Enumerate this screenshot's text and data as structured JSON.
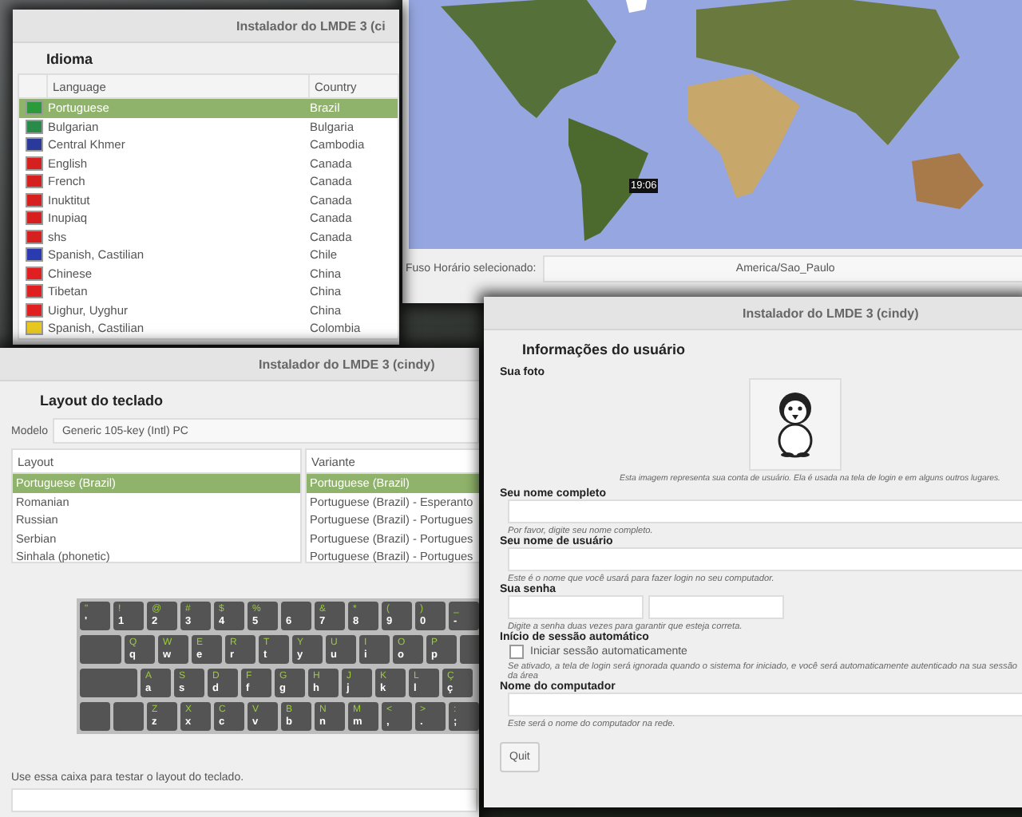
{
  "language_window": {
    "title": "Instalador do LMDE 3 (ci",
    "heading": "Idioma",
    "columns": [
      "Language",
      "Country"
    ],
    "rows": [
      {
        "language": "Portuguese",
        "country": "Brazil",
        "color": "#2a9a3a",
        "selected": true
      },
      {
        "language": "Bulgarian",
        "country": "Bulgaria",
        "color": "#2a8a4a",
        "selected": false
      },
      {
        "language": "Central Khmer",
        "country": "Cambodia",
        "color": "#2a3a9a",
        "selected": false
      },
      {
        "language": "English",
        "country": "Canada",
        "color": "#d62020",
        "selected": false
      },
      {
        "language": "French",
        "country": "Canada",
        "color": "#d62020",
        "selected": false
      },
      {
        "language": "Inuktitut",
        "country": "Canada",
        "color": "#d62020",
        "selected": false
      },
      {
        "language": "Inupiaq",
        "country": "Canada",
        "color": "#d62020",
        "selected": false
      },
      {
        "language": "shs",
        "country": "Canada",
        "color": "#d62020",
        "selected": false
      },
      {
        "language": "Spanish, Castilian",
        "country": "Chile",
        "color": "#2a3ab0",
        "selected": false
      },
      {
        "language": "Chinese",
        "country": "China",
        "color": "#e02020",
        "selected": false
      },
      {
        "language": "Tibetan",
        "country": "China",
        "color": "#e02020",
        "selected": false
      },
      {
        "language": "Uighur, Uyghur",
        "country": "China",
        "color": "#e02020",
        "selected": false
      },
      {
        "language": "Spanish, Castilian",
        "country": "Colombia",
        "color": "#e8c820",
        "selected": false
      }
    ]
  },
  "timezone_window": {
    "clock": "19:06",
    "label": "Fuso Horário selecionado:",
    "value": "America/Sao_Paulo"
  },
  "keyboard_window": {
    "title": "Instalador do LMDE 3 (cindy)",
    "heading": "Layout do teclado",
    "model_label": "Modelo",
    "model_value": "Generic 105-key (Intl) PC",
    "layout_column": "Layout",
    "variant_column": "Variante",
    "layouts": [
      {
        "label": "Portuguese (Brazil)",
        "selected": true
      },
      {
        "label": "Romanian",
        "selected": false
      },
      {
        "label": "Russian",
        "selected": false
      },
      {
        "label": "Serbian",
        "selected": false
      },
      {
        "label": "Sinhala (phonetic)",
        "selected": false
      }
    ],
    "variants": [
      {
        "label": "Portuguese (Brazil)",
        "selected": true
      },
      {
        "label": "Portuguese (Brazil) - Esperanto",
        "selected": false
      },
      {
        "label": "Portuguese (Brazil) - Portugues",
        "selected": false
      },
      {
        "label": "Portuguese (Brazil) - Portugues",
        "selected": false
      },
      {
        "label": "Portuguese (Brazil) - Portugues",
        "selected": false
      }
    ],
    "keys": [
      [
        {
          "kind": "char",
          "upper": "\"",
          "lower": "'"
        },
        {
          "kind": "char",
          "upper": "!",
          "lower": "1"
        },
        {
          "kind": "char",
          "upper": "@",
          "lower": "2"
        },
        {
          "kind": "char",
          "upper": "#",
          "lower": "3"
        },
        {
          "kind": "char",
          "upper": "$",
          "lower": "4"
        },
        {
          "kind": "char",
          "upper": "%",
          "lower": "5"
        },
        {
          "kind": "char",
          "lower": "6"
        },
        {
          "kind": "char",
          "upper": "&",
          "lower": "7"
        },
        {
          "kind": "char",
          "upper": "*",
          "lower": "8"
        },
        {
          "kind": "char",
          "upper": "(",
          "lower": "9"
        },
        {
          "kind": "char",
          "upper": ")",
          "lower": "0"
        },
        {
          "kind": "char",
          "upper": "_",
          "lower": "-"
        }
      ],
      [
        {
          "kind": "wide"
        },
        {
          "kind": "char",
          "upper": "Q",
          "lower": "q"
        },
        {
          "kind": "char",
          "upper": "W",
          "lower": "w"
        },
        {
          "kind": "char",
          "upper": "E",
          "lower": "e"
        },
        {
          "kind": "char",
          "upper": "R",
          "lower": "r"
        },
        {
          "kind": "char",
          "upper": "T",
          "lower": "t"
        },
        {
          "kind": "char",
          "upper": "Y",
          "lower": "y"
        },
        {
          "kind": "char",
          "upper": "U",
          "lower": "u"
        },
        {
          "kind": "char",
          "upper": "I",
          "lower": "i"
        },
        {
          "kind": "char",
          "upper": "O",
          "lower": "o"
        },
        {
          "kind": "char",
          "upper": "P",
          "lower": "p"
        },
        {
          "kind": "blank"
        }
      ],
      [
        {
          "kind": "wider"
        },
        {
          "kind": "char",
          "upper": "A",
          "lower": "a"
        },
        {
          "kind": "char",
          "upper": "S",
          "lower": "s"
        },
        {
          "kind": "char",
          "upper": "D",
          "lower": "d"
        },
        {
          "kind": "char",
          "upper": "F",
          "lower": "f"
        },
        {
          "kind": "char",
          "upper": "G",
          "lower": "g"
        },
        {
          "kind": "char",
          "upper": "H",
          "lower": "h"
        },
        {
          "kind": "char",
          "upper": "J",
          "lower": "j"
        },
        {
          "kind": "char",
          "upper": "K",
          "lower": "k"
        },
        {
          "kind": "char",
          "upper": "L",
          "lower": "l"
        },
        {
          "kind": "char",
          "upper": "Ç",
          "lower": "ç"
        }
      ],
      [
        {
          "kind": "blank"
        },
        {
          "kind": "blank"
        },
        {
          "kind": "char",
          "upper": "Z",
          "lower": "z"
        },
        {
          "kind": "char",
          "upper": "X",
          "lower": "x"
        },
        {
          "kind": "char",
          "upper": "C",
          "lower": "c"
        },
        {
          "kind": "char",
          "upper": "V",
          "lower": "v"
        },
        {
          "kind": "char",
          "upper": "B",
          "lower": "b"
        },
        {
          "kind": "char",
          "upper": "N",
          "lower": "n"
        },
        {
          "kind": "char",
          "upper": "M",
          "lower": "m"
        },
        {
          "kind": "char",
          "upper": "<",
          "lower": ","
        },
        {
          "kind": "char",
          "upper": ">",
          "lower": "."
        },
        {
          "kind": "char",
          "upper": ":",
          "lower": ";"
        }
      ]
    ],
    "test_label": "Use essa caixa para testar o layout do teclado."
  },
  "user_window": {
    "title": "Instalador do LMDE 3 (cindy)",
    "heading": "Informações do usuário",
    "photo_label": "Sua foto",
    "photo_caption": "Esta imagem representa sua conta de usuário. Ela é usada na tela de login e em alguns outros lugares.",
    "full_name_label": "Seu nome completo",
    "full_name_hint": "Por favor, digite seu nome completo.",
    "username_label": "Seu nome de usuário",
    "username_hint": "Este é o nome que você usará para fazer login no seu computador.",
    "password_label": "Sua senha",
    "password_hint": "Digite a senha duas vezes para garantir que esteja correta.",
    "autologin_label": "Início de sessão automático",
    "autologin_checkbox": {
      "label": "Iniciar sessão automaticamente",
      "checked": false
    },
    "autologin_hint": "Se ativado, a tela de login será ignorada quando o sistema for iniciado, e você será automaticamente autenticado na sua sessão da área",
    "computer_label": "Nome do computador",
    "computer_hint": "Este será o nome do computador na rede.",
    "quit_button": "Quit"
  }
}
